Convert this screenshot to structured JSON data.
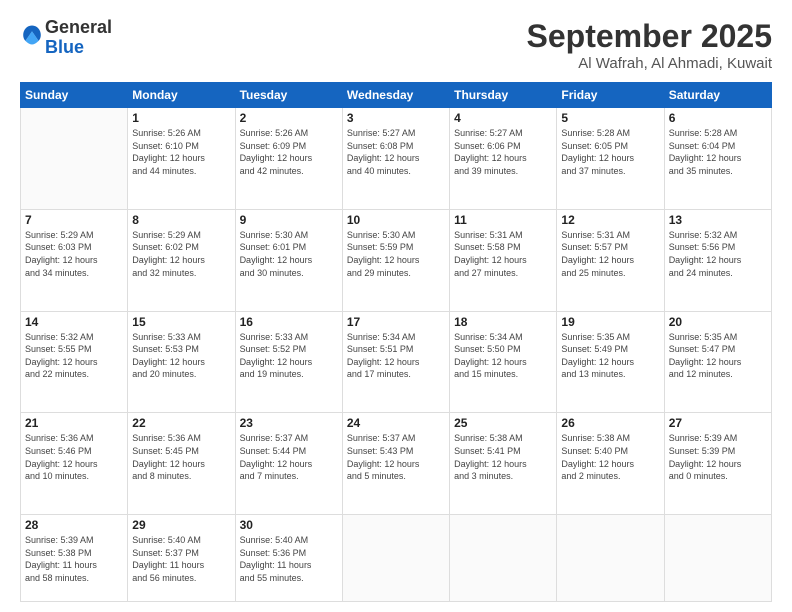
{
  "header": {
    "logo_general": "General",
    "logo_blue": "Blue",
    "month": "September 2025",
    "location": "Al Wafrah, Al Ahmadi, Kuwait"
  },
  "days_of_week": [
    "Sunday",
    "Monday",
    "Tuesday",
    "Wednesday",
    "Thursday",
    "Friday",
    "Saturday"
  ],
  "weeks": [
    [
      {
        "day": "",
        "info": ""
      },
      {
        "day": "1",
        "info": "Sunrise: 5:26 AM\nSunset: 6:10 PM\nDaylight: 12 hours\nand 44 minutes."
      },
      {
        "day": "2",
        "info": "Sunrise: 5:26 AM\nSunset: 6:09 PM\nDaylight: 12 hours\nand 42 minutes."
      },
      {
        "day": "3",
        "info": "Sunrise: 5:27 AM\nSunset: 6:08 PM\nDaylight: 12 hours\nand 40 minutes."
      },
      {
        "day": "4",
        "info": "Sunrise: 5:27 AM\nSunset: 6:06 PM\nDaylight: 12 hours\nand 39 minutes."
      },
      {
        "day": "5",
        "info": "Sunrise: 5:28 AM\nSunset: 6:05 PM\nDaylight: 12 hours\nand 37 minutes."
      },
      {
        "day": "6",
        "info": "Sunrise: 5:28 AM\nSunset: 6:04 PM\nDaylight: 12 hours\nand 35 minutes."
      }
    ],
    [
      {
        "day": "7",
        "info": "Sunrise: 5:29 AM\nSunset: 6:03 PM\nDaylight: 12 hours\nand 34 minutes."
      },
      {
        "day": "8",
        "info": "Sunrise: 5:29 AM\nSunset: 6:02 PM\nDaylight: 12 hours\nand 32 minutes."
      },
      {
        "day": "9",
        "info": "Sunrise: 5:30 AM\nSunset: 6:01 PM\nDaylight: 12 hours\nand 30 minutes."
      },
      {
        "day": "10",
        "info": "Sunrise: 5:30 AM\nSunset: 5:59 PM\nDaylight: 12 hours\nand 29 minutes."
      },
      {
        "day": "11",
        "info": "Sunrise: 5:31 AM\nSunset: 5:58 PM\nDaylight: 12 hours\nand 27 minutes."
      },
      {
        "day": "12",
        "info": "Sunrise: 5:31 AM\nSunset: 5:57 PM\nDaylight: 12 hours\nand 25 minutes."
      },
      {
        "day": "13",
        "info": "Sunrise: 5:32 AM\nSunset: 5:56 PM\nDaylight: 12 hours\nand 24 minutes."
      }
    ],
    [
      {
        "day": "14",
        "info": "Sunrise: 5:32 AM\nSunset: 5:55 PM\nDaylight: 12 hours\nand 22 minutes."
      },
      {
        "day": "15",
        "info": "Sunrise: 5:33 AM\nSunset: 5:53 PM\nDaylight: 12 hours\nand 20 minutes."
      },
      {
        "day": "16",
        "info": "Sunrise: 5:33 AM\nSunset: 5:52 PM\nDaylight: 12 hours\nand 19 minutes."
      },
      {
        "day": "17",
        "info": "Sunrise: 5:34 AM\nSunset: 5:51 PM\nDaylight: 12 hours\nand 17 minutes."
      },
      {
        "day": "18",
        "info": "Sunrise: 5:34 AM\nSunset: 5:50 PM\nDaylight: 12 hours\nand 15 minutes."
      },
      {
        "day": "19",
        "info": "Sunrise: 5:35 AM\nSunset: 5:49 PM\nDaylight: 12 hours\nand 13 minutes."
      },
      {
        "day": "20",
        "info": "Sunrise: 5:35 AM\nSunset: 5:47 PM\nDaylight: 12 hours\nand 12 minutes."
      }
    ],
    [
      {
        "day": "21",
        "info": "Sunrise: 5:36 AM\nSunset: 5:46 PM\nDaylight: 12 hours\nand 10 minutes."
      },
      {
        "day": "22",
        "info": "Sunrise: 5:36 AM\nSunset: 5:45 PM\nDaylight: 12 hours\nand 8 minutes."
      },
      {
        "day": "23",
        "info": "Sunrise: 5:37 AM\nSunset: 5:44 PM\nDaylight: 12 hours\nand 7 minutes."
      },
      {
        "day": "24",
        "info": "Sunrise: 5:37 AM\nSunset: 5:43 PM\nDaylight: 12 hours\nand 5 minutes."
      },
      {
        "day": "25",
        "info": "Sunrise: 5:38 AM\nSunset: 5:41 PM\nDaylight: 12 hours\nand 3 minutes."
      },
      {
        "day": "26",
        "info": "Sunrise: 5:38 AM\nSunset: 5:40 PM\nDaylight: 12 hours\nand 2 minutes."
      },
      {
        "day": "27",
        "info": "Sunrise: 5:39 AM\nSunset: 5:39 PM\nDaylight: 12 hours\nand 0 minutes."
      }
    ],
    [
      {
        "day": "28",
        "info": "Sunrise: 5:39 AM\nSunset: 5:38 PM\nDaylight: 11 hours\nand 58 minutes."
      },
      {
        "day": "29",
        "info": "Sunrise: 5:40 AM\nSunset: 5:37 PM\nDaylight: 11 hours\nand 56 minutes."
      },
      {
        "day": "30",
        "info": "Sunrise: 5:40 AM\nSunset: 5:36 PM\nDaylight: 11 hours\nand 55 minutes."
      },
      {
        "day": "",
        "info": ""
      },
      {
        "day": "",
        "info": ""
      },
      {
        "day": "",
        "info": ""
      },
      {
        "day": "",
        "info": ""
      }
    ]
  ]
}
